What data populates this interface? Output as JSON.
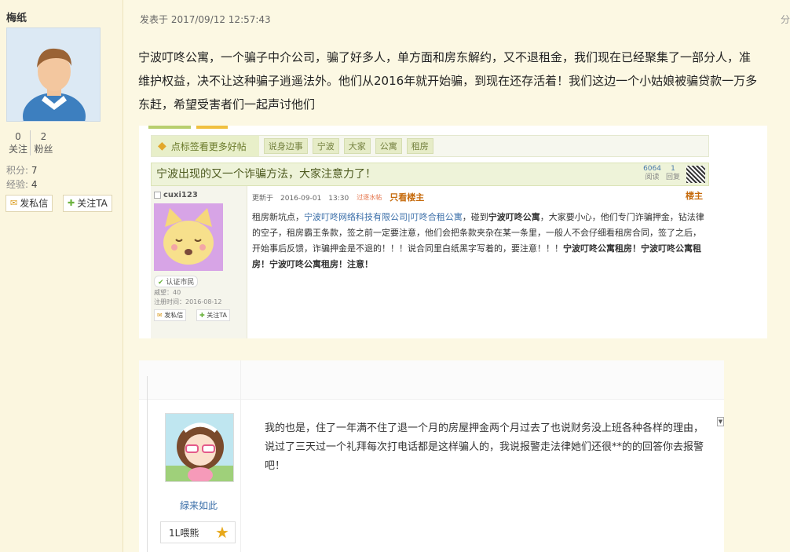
{
  "user": {
    "name": "梅纸",
    "follow_count": "0",
    "follow_label": "关注",
    "fans_count": "2",
    "fans_label": "粉丝",
    "points_label": "积分:",
    "points_value": "7",
    "exp_label": "经验:",
    "exp_value": "4",
    "message_button": "发私信",
    "follow_button": "关注TA"
  },
  "post": {
    "time": "发表于 2017/09/12 12:57:43",
    "time_right": "分",
    "lines": [
      "宁波叮咚公寓，一个骗子中介公司，骗了好多人，单方面和房东解约，又不退租金，我们现在已经聚集了一部分人，准",
      "维护权益，决不让这种骗子逍遥法外。他们从2016年就开始骗，到现在还存活着！我们这边一个小姑娘被骗贷款一万多",
      "东赶，希望受害者们一起声讨他们"
    ]
  },
  "embed1": {
    "tag_header": "点标签看更多好帖",
    "tags": [
      "说身边事",
      "宁波",
      "大家",
      "公寓",
      "租房"
    ],
    "title": "宁波出现的又一个诈骗方法，大家注意力了！",
    "views": "6064",
    "views_label": "阅读",
    "replies": "1",
    "replies_label": "回复",
    "author": "cuxi123",
    "badge": "认证市民",
    "prestige": "威望：40",
    "register": "注册时间：2016-08-12",
    "msg_btn": "发私信",
    "follow_btn": "关注TA",
    "update_time": "更新于　2016-09-01　13:30",
    "tag_red": "过逐水帖",
    "only_author": "只看楼主",
    "floor": "楼主",
    "body_p1": "租房新坑点，",
    "body_link": "宁波叮咚网络科技有限公司|叮咚合租公寓",
    "body_p2": "，碰到",
    "body_b1": "宁波叮咚公寓",
    "body_p3": "，大家要小心，他们专门诈骗押金，钻法律的空子，租房霸王条款，签之前一定要注意，他们会把条款夹杂在某一条里，一般人不会仔细看租房合同，签了之后，开始事后反馈，诈骗押金是不退的！！！说合同里白纸黑字写着的，要注意！！！",
    "body_b2": "宁波叮咚公寓租房！宁波叮咚公寓租房！宁波叮咚公寓租房！注意！"
  },
  "embed2": {
    "username": "緑来如此",
    "level": "1L喂熊",
    "level_icon": "star-icon",
    "comment": "我的也是，住了一年满不住了退一个月的房屋押金两个月过去了也说财务没上班各种各样的理由，说过了三天过一个礼拜每次打电话都是这样骗人的，我说报警走法律她们还很**的的回答你去报警吧！"
  }
}
